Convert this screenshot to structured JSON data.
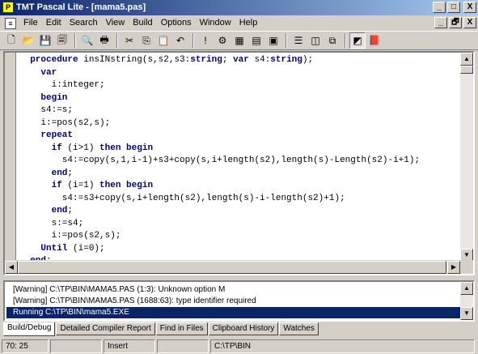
{
  "window": {
    "title": "TMT Pascal Lite - [mama5.pas]",
    "minimize_glyph": "_",
    "maximize_glyph": "□",
    "close_glyph": "X"
  },
  "menu": {
    "items": [
      "File",
      "Edit",
      "Search",
      "View",
      "Build",
      "Options",
      "Window",
      "Help"
    ],
    "doc_minimize_glyph": "_",
    "doc_restore_glyph": "🗗",
    "doc_close_glyph": "X"
  },
  "toolbar": {
    "buttons": [
      {
        "name": "new-icon",
        "glyph": "🗋"
      },
      {
        "name": "open-icon",
        "glyph": "📂"
      },
      {
        "name": "save-icon",
        "glyph": "💾"
      },
      {
        "name": "save-all-icon",
        "glyph": "🗐"
      },
      {
        "name": "print-preview-icon",
        "glyph": "🔍"
      },
      {
        "name": "print-icon",
        "glyph": "🖶"
      },
      {
        "name": "cut-icon",
        "glyph": "✂"
      },
      {
        "name": "copy-icon",
        "glyph": "⎘"
      },
      {
        "name": "paste-icon",
        "glyph": "📋"
      },
      {
        "name": "undo-icon",
        "glyph": "↶"
      },
      {
        "name": "compile-icon",
        "glyph": "!"
      },
      {
        "name": "build-icon",
        "glyph": "⚙"
      },
      {
        "name": "make-icon",
        "glyph": "▦"
      },
      {
        "name": "debug-icon",
        "glyph": "▤"
      },
      {
        "name": "run-icon",
        "glyph": "▣"
      },
      {
        "name": "tile-horizontal-icon",
        "glyph": "☰"
      },
      {
        "name": "tile-vertical-icon",
        "glyph": "◫"
      },
      {
        "name": "cascade-icon",
        "glyph": "⧉"
      },
      {
        "name": "output-window-icon",
        "glyph": "◩"
      },
      {
        "name": "help-book-icon",
        "glyph": "📕"
      }
    ],
    "active_index": 18
  },
  "editor": {
    "lines": [
      [
        {
          "t": "  "
        },
        {
          "t": "procedure",
          "k": 1
        },
        {
          "t": " insINstring(s,s2,s3:"
        },
        {
          "t": "string",
          "k": 1
        },
        {
          "t": "; "
        },
        {
          "t": "var",
          "k": 1
        },
        {
          "t": " s4:"
        },
        {
          "t": "string",
          "k": 1
        },
        {
          "t": ");"
        }
      ],
      [
        {
          "t": "    "
        },
        {
          "t": "var",
          "k": 1
        }
      ],
      [
        {
          "t": "      i:integer;"
        }
      ],
      [
        {
          "t": "    "
        },
        {
          "t": "begin",
          "k": 1
        }
      ],
      [
        {
          "t": "    s4:=s;"
        }
      ],
      [
        {
          "t": "    i:=pos(s2,s);"
        }
      ],
      [
        {
          "t": "    "
        },
        {
          "t": "repeat",
          "k": 1
        }
      ],
      [
        {
          "t": "      "
        },
        {
          "t": "if",
          "k": 1
        },
        {
          "t": " (i>1) "
        },
        {
          "t": "then",
          "k": 1
        },
        {
          "t": " "
        },
        {
          "t": "begin",
          "k": 1
        }
      ],
      [
        {
          "t": "        s4:=copy(s,1,i-1)+s3+copy(s,i+length(s2),length(s)-Length(s2)-i+1);"
        }
      ],
      [
        {
          "t": "      "
        },
        {
          "t": "end",
          "k": 1
        },
        {
          "t": ";"
        }
      ],
      [
        {
          "t": "      "
        },
        {
          "t": "if",
          "k": 1
        },
        {
          "t": " (i=1) "
        },
        {
          "t": "then",
          "k": 1
        },
        {
          "t": " "
        },
        {
          "t": "begin",
          "k": 1
        }
      ],
      [
        {
          "t": "        s4:=s3+copy(s,i+length(s2),length(s)-i-length(s2)+1);"
        }
      ],
      [
        {
          "t": "      "
        },
        {
          "t": "end",
          "k": 1
        },
        {
          "t": ";"
        }
      ],
      [
        {
          "t": "      s:=s4;"
        }
      ],
      [
        {
          "t": "      i:=pos(s2,s);"
        }
      ],
      [
        {
          "t": "    "
        },
        {
          "t": "Until",
          "k": 1
        },
        {
          "t": " (i=0);"
        }
      ],
      [
        {
          "t": "  "
        },
        {
          "t": "end",
          "k": 1
        },
        {
          "t": ";"
        }
      ]
    ]
  },
  "output": {
    "messages": [
      "[Warning] C:\\TP\\BIN\\MAMA5.PAS (1:3): Unknown option M",
      "[Warning] C:\\TP\\BIN\\MAMA5.PAS (1688:63): type identifier required",
      "Running C:\\TP\\BIN\\mama5.EXE"
    ],
    "selected_index": 2
  },
  "tabs": [
    "Build/Debug",
    "Detailed Compiler Report",
    "Find in Files",
    "Clipboard History",
    "Watches"
  ],
  "status": {
    "position": "70: 25",
    "cell2": "",
    "mode": "Insert",
    "cell4": "",
    "directory": "C:\\TP\\BIN"
  }
}
